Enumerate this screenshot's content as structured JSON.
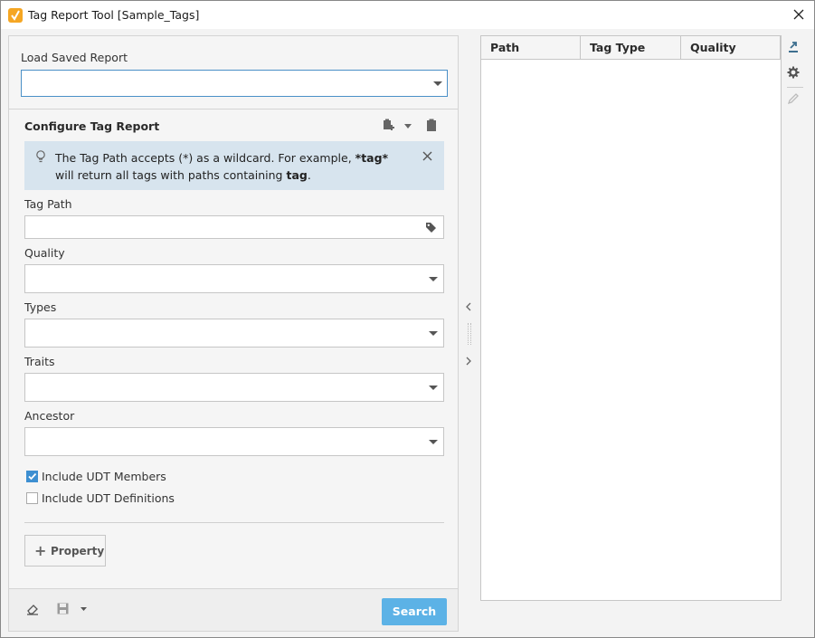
{
  "window": {
    "title": "Tag Report Tool [Sample_Tags]"
  },
  "icons": {
    "app": "tag-report-icon",
    "close": "close-icon",
    "add_property": "plus-icon"
  },
  "colors": {
    "accent": "#4a90c7",
    "info_bg": "#d7e4ee",
    "search_button": "#5cb2e6",
    "checkbox_checked": "#3d8fd1"
  },
  "load": {
    "label": "Load Saved Report",
    "value": ""
  },
  "configure": {
    "title": "Configure Tag Report",
    "info_prefix": "The Tag Path accepts (*) as a wildcard. For example, ",
    "info_bold1": "*tag*",
    "info_mid": " will return all tags with paths containing ",
    "info_bold2": "tag",
    "info_suffix": "."
  },
  "fields": {
    "tag_path": {
      "label": "Tag Path",
      "value": ""
    },
    "quality": {
      "label": "Quality",
      "value": ""
    },
    "types": {
      "label": "Types",
      "value": ""
    },
    "traits": {
      "label": "Traits",
      "value": ""
    },
    "ancestor": {
      "label": "Ancestor",
      "value": ""
    }
  },
  "checkboxes": [
    {
      "label": "Include UDT Members",
      "checked": true
    },
    {
      "label": "Include UDT Definitions",
      "checked": false
    }
  ],
  "property_button": {
    "label": "Property"
  },
  "search_button": {
    "label": "Search"
  },
  "table": {
    "columns": [
      "Path",
      "Tag Type",
      "Quality"
    ],
    "rows": []
  }
}
